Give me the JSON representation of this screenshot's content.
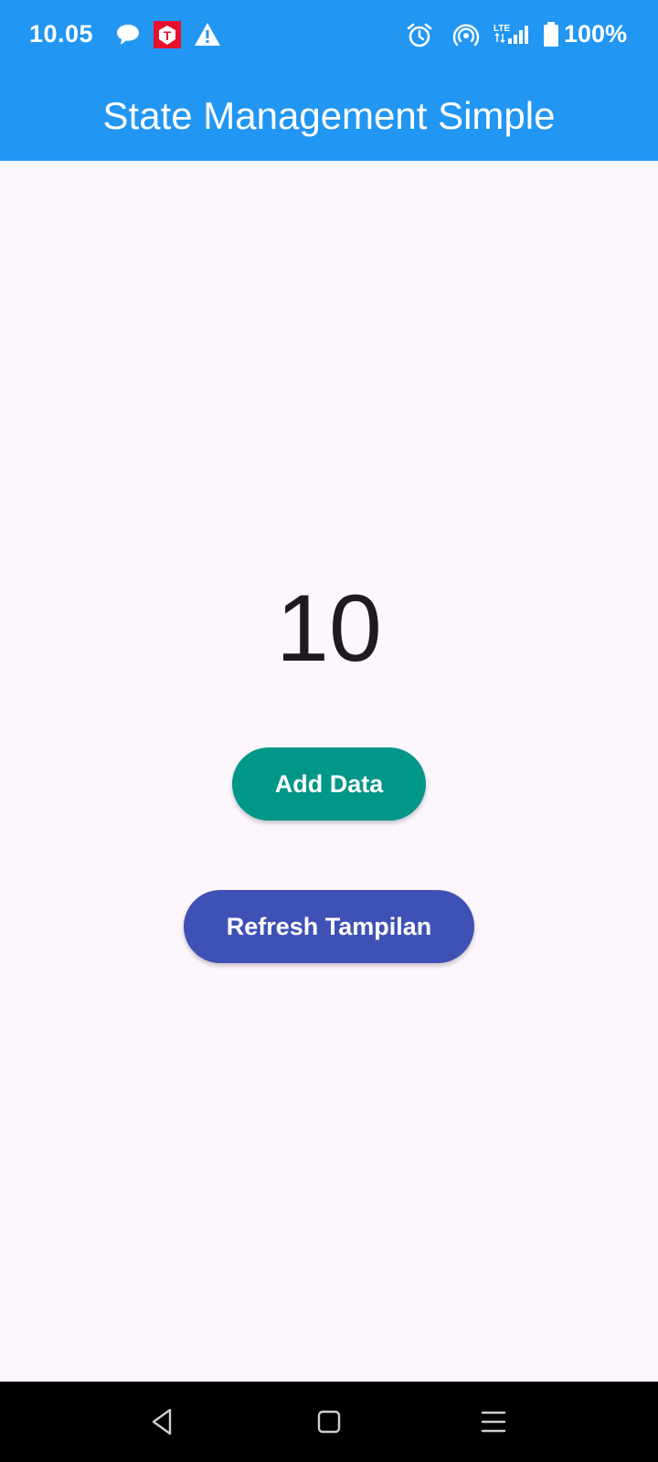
{
  "status_bar": {
    "time": "10.05",
    "icons": [
      "chat-bubble-icon",
      "t-app-icon",
      "warning-icon",
      "alarm-icon",
      "hotspot-icon",
      "lte-signal-icon",
      "battery-icon"
    ],
    "battery": "100%",
    "network": "LTE"
  },
  "app_bar": {
    "title": "State Management Simple",
    "color": "#2196f3"
  },
  "main": {
    "counter_value": "10",
    "add_button_label": "Add Data",
    "add_button_color": "#009688",
    "refresh_button_label": "Refresh Tampilan",
    "refresh_button_color": "#3f51b5"
  },
  "nav_bar": {
    "items": [
      "back-icon",
      "home-icon",
      "menu-icon"
    ]
  }
}
